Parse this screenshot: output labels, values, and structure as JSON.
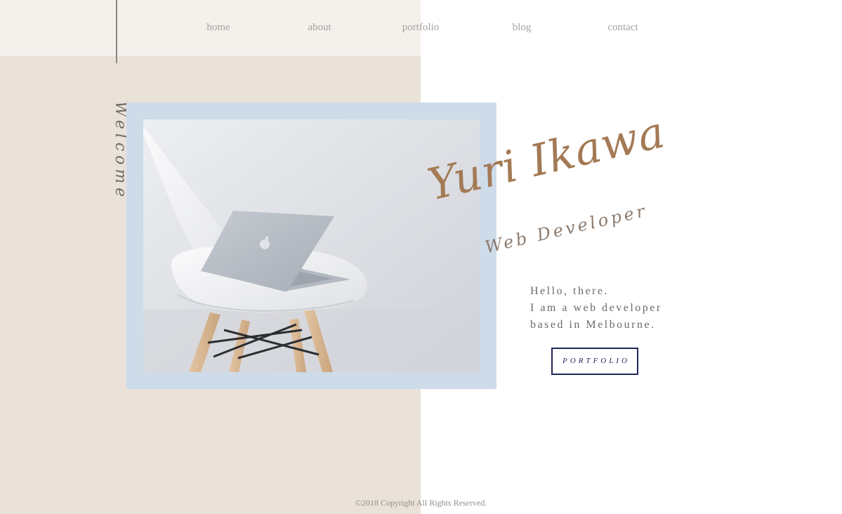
{
  "nav": {
    "items": [
      {
        "label": "home"
      },
      {
        "label": "about"
      },
      {
        "label": "portfolio"
      },
      {
        "label": "blog"
      },
      {
        "label": "contact"
      }
    ]
  },
  "hero": {
    "side_label": "Welcome",
    "name": "Yuri Ikawa",
    "role": "Web Developer",
    "intro_lines": [
      "Hello, there.",
      "I am a web developer",
      "based in Melbourne."
    ],
    "cta_label": "PORTFOLIO"
  },
  "photo": {
    "subject": "laptop on white chair"
  },
  "footer": {
    "copyright": "©2018 Copyright All Rights Reserved."
  },
  "colors": {
    "left_panel": "#eae1d9",
    "top_band": "#f4f0ec",
    "photo_frame": "#cedbe9",
    "name_accent": "#a37a55",
    "button_navy": "#1f2657"
  }
}
